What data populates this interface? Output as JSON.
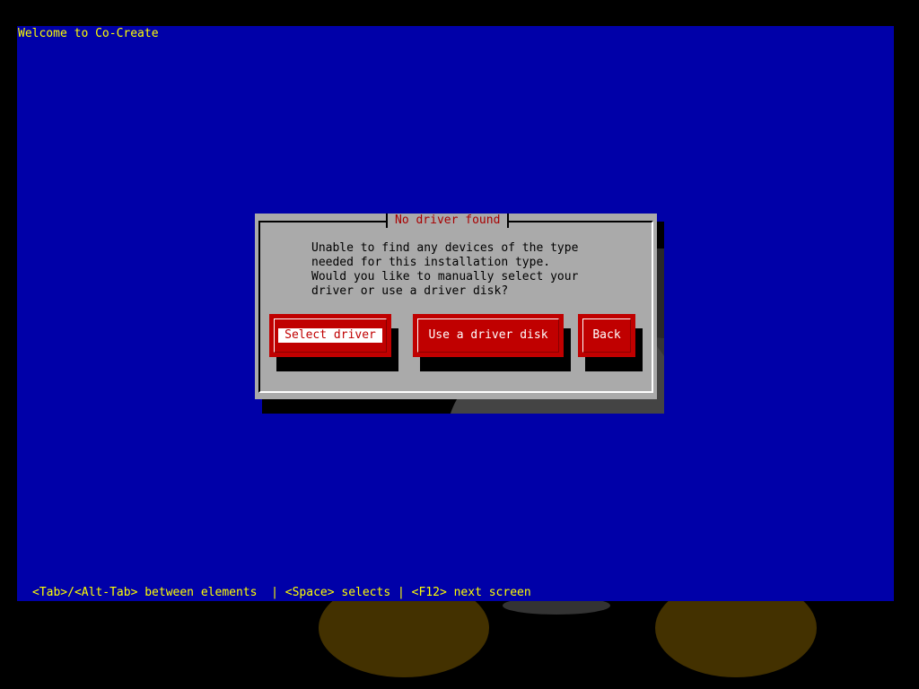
{
  "screen": {
    "title": "Welcome to Co-Create",
    "help_line": "<Tab>/<Alt-Tab> between elements  | <Space> selects | <F12> next screen"
  },
  "dialog": {
    "title": "No driver found",
    "message": "Unable to find any devices of the type\nneeded for this installation type.\nWould you like to manually select your\ndriver or use a driver disk?",
    "buttons": {
      "select_driver": "Select driver",
      "driver_disk": "Use a driver disk",
      "back": "Back"
    }
  },
  "colors": {
    "background": "#0000a8",
    "text_yellow": "#ffff00",
    "dialog_gray": "#aaaaaa",
    "button_red": "#c00000",
    "title_red": "#a80000"
  }
}
